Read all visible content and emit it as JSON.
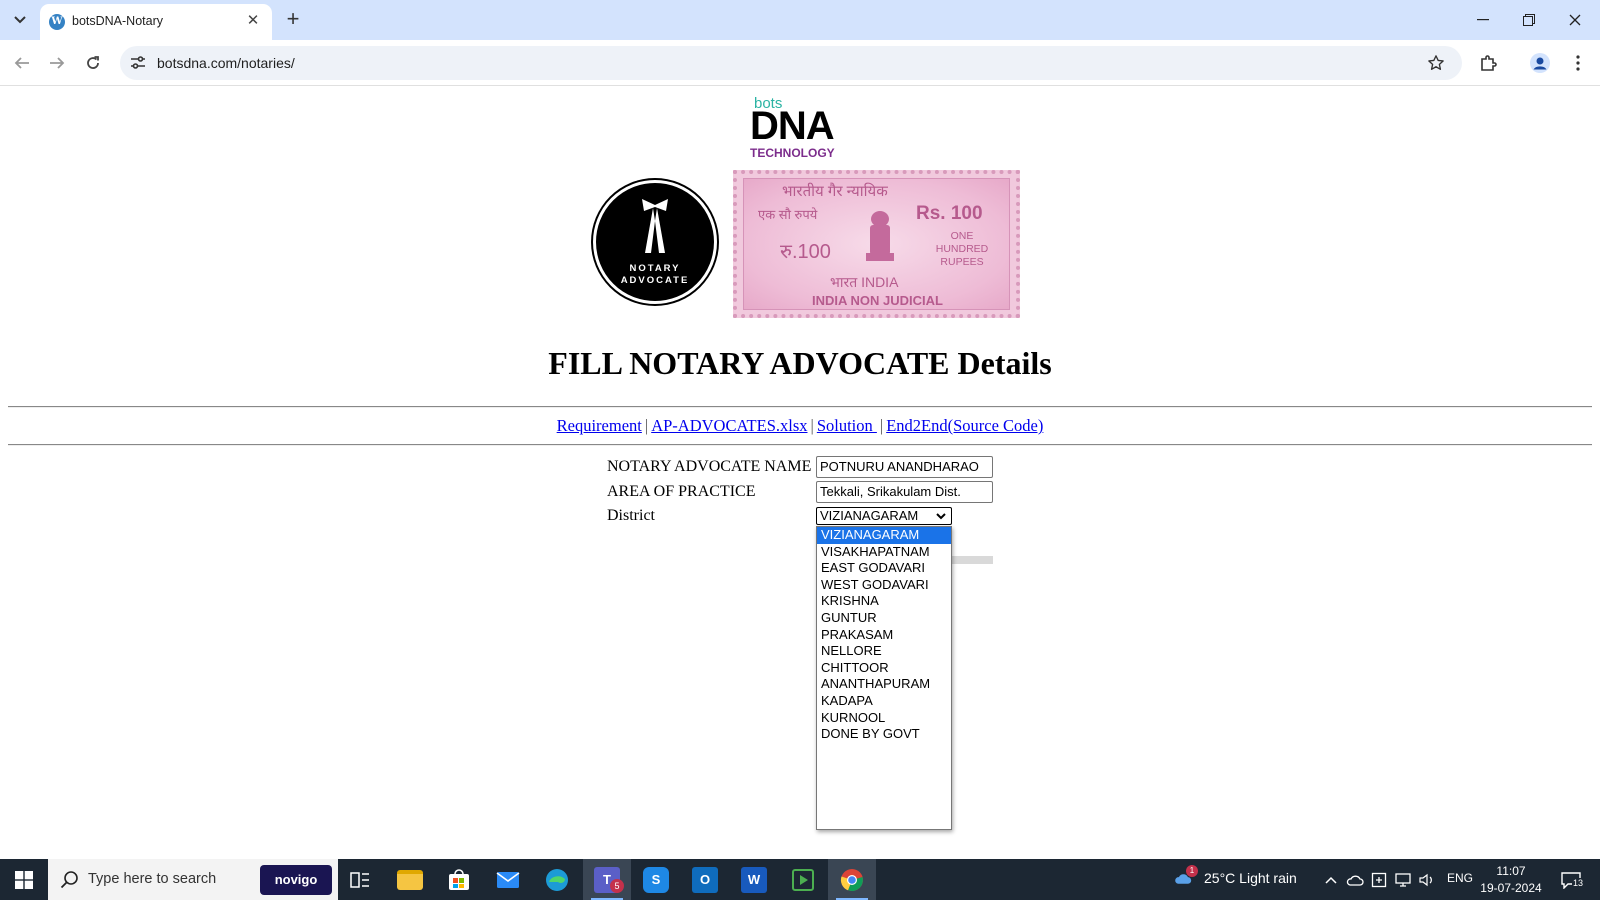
{
  "browser": {
    "tab_title": "botsDNA-Notary",
    "url": "botsdna.com/notaries/"
  },
  "logo": {
    "bots": "bots",
    "dna": "DNA",
    "tagline": "TECHNOLOGY"
  },
  "seal": {
    "line1": "NOTARY",
    "line2": "ADVOCATE"
  },
  "stamp": {
    "hindi_top": "भारतीय गैर न्यायिक",
    "hindi_amount": "एक सौ रुपये",
    "rs_left": "रु.100",
    "rs_right": "Rs. 100",
    "words": "ONE HUNDRED RUPEES",
    "india": "भारत INDIA",
    "non_judicial": "INDIA NON JUDICIAL"
  },
  "page": {
    "title": "FILL NOTARY ADVOCATE Details"
  },
  "links": [
    {
      "label": "Requirement"
    },
    {
      "label": "AP-ADVOCATES.xlsx"
    },
    {
      "label": "Solution "
    },
    {
      "label": "End2End(Source Code)"
    }
  ],
  "link_separator": "|",
  "form": {
    "name_label": "NOTARY ADVOCATE NAME",
    "name_value": "POTNURU ANANDHARAO",
    "area_label": "AREA OF PRACTICE",
    "area_value": "Tekkali, Srikakulam Dist.",
    "district_label": "District",
    "district_value": "VIZIANAGARAM"
  },
  "district_options": [
    "VIZIANAGARAM",
    "VISAKHAPATNAM",
    "EAST GODAVARI",
    "WEST GODAVARI",
    "KRISHNA",
    "GUNTUR",
    "PRAKASAM",
    "NELLORE",
    "CHITTOOR",
    "ANANTHAPURAM",
    "KADAPA",
    "KURNOOL",
    "DONE BY GOVT"
  ],
  "taskbar": {
    "search_placeholder": "Type here to search",
    "novigo": "novigo",
    "weather": "25°C  Light rain",
    "language": "ENG",
    "time": "11:07",
    "date": "19-07-2024",
    "notification_count": "13",
    "teams_badge": "5",
    "weather_badge": "1"
  },
  "colors": {
    "tabbar": "#d3e3fd",
    "link": "#0000ee",
    "selected_option": "#1a73e8",
    "taskbar": "#1c2733"
  }
}
